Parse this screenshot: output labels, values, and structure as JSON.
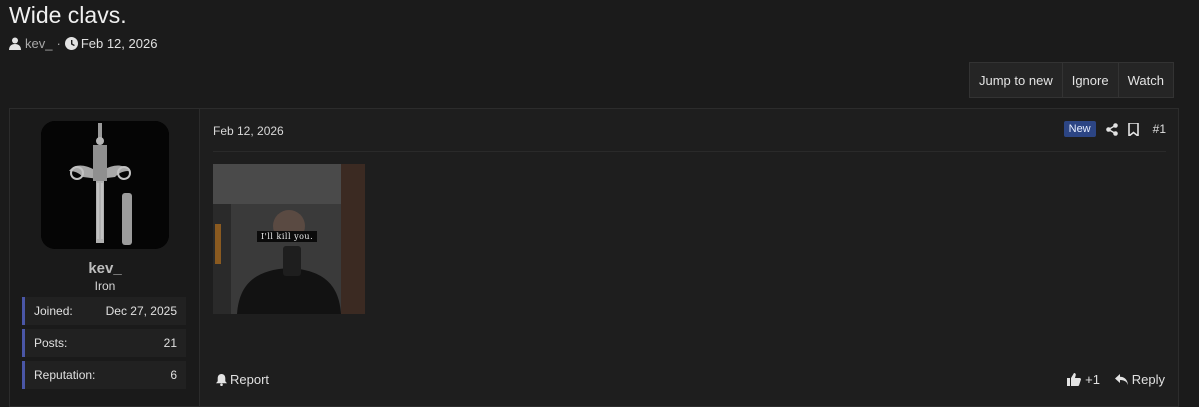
{
  "thread": {
    "title": "Wide clavs.",
    "author": "kev_",
    "separator": "·",
    "date": "Feb 12, 2026"
  },
  "actions": {
    "jump_to_new": "Jump to new",
    "ignore": "Ignore",
    "watch": "Watch"
  },
  "post": {
    "date": "Feb 12, 2026",
    "badge": "New",
    "number": "#1",
    "image_caption": "I'll kill you.",
    "report_label": "Report",
    "reaction_count": "+1",
    "reply_label": "Reply"
  },
  "user": {
    "name": "kev_",
    "title": "Iron",
    "stats": [
      {
        "label": "Joined:",
        "value": "Dec 27, 2025"
      },
      {
        "label": "Posts:",
        "value": "21"
      },
      {
        "label": "Reputation:",
        "value": "6"
      }
    ]
  },
  "icons": {
    "user": "user-icon",
    "clock": "clock-icon",
    "share": "share-icon",
    "bookmark": "bookmark-icon",
    "bell": "bell-icon",
    "thumbs_up": "thumbs-up-icon",
    "reply": "reply-icon"
  },
  "colors": {
    "background": "#1b1b1b",
    "new_badge": "#2c4584",
    "stat_accent": "#4a56a6"
  }
}
